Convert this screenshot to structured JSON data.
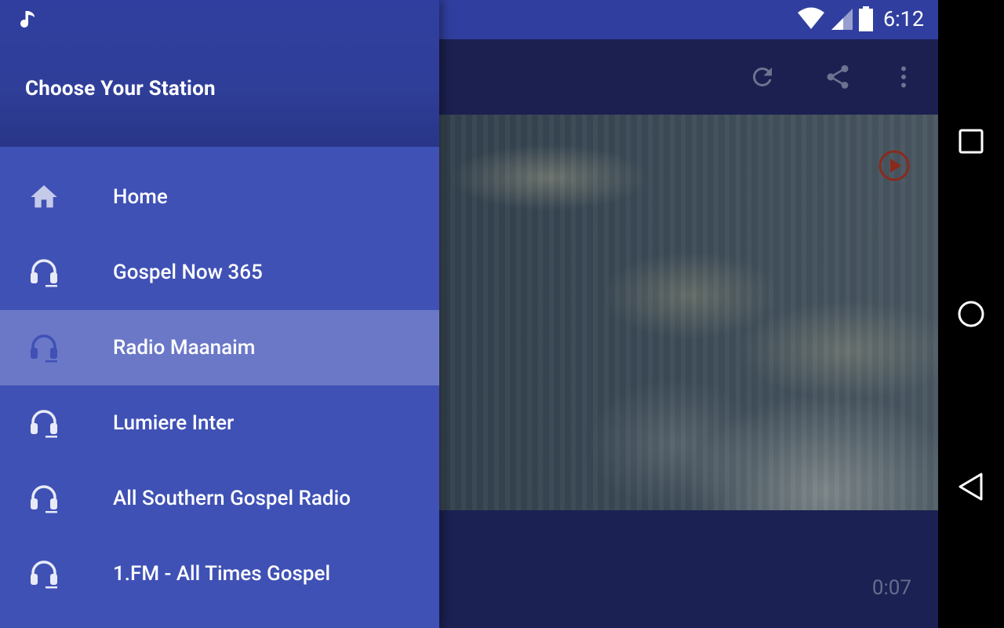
{
  "status_bar": {
    "time": "6:12",
    "icons": [
      "music-note-icon",
      "wifi-icon",
      "signal-icon",
      "battery-icon"
    ]
  },
  "toolbar": {
    "actions": [
      "refresh-icon",
      "share-icon",
      "more-vert-icon"
    ]
  },
  "drawer": {
    "title": "Choose Your Station",
    "items": [
      {
        "label": "Home",
        "icon": "home-icon",
        "selected": false
      },
      {
        "label": "Gospel Now 365",
        "icon": "headphones-icon",
        "selected": false
      },
      {
        "label": "Radio Maanaim",
        "icon": "headphones-icon",
        "selected": true
      },
      {
        "label": "Lumiere Inter",
        "icon": "headphones-icon",
        "selected": false
      },
      {
        "label": "All Southern Gospel Radio",
        "icon": "headphones-icon",
        "selected": false
      },
      {
        "label": "1.FM - All Times Gospel",
        "icon": "headphones-icon",
        "selected": false
      }
    ]
  },
  "player": {
    "elapsed": "0:07"
  },
  "colors": {
    "primary": "#3f51b5",
    "primary_dark": "#303f9f",
    "selected_item": "#6b78c8",
    "play_icon": "#a0301e"
  },
  "nav_bar": [
    "recents-button",
    "home-button",
    "back-button"
  ]
}
